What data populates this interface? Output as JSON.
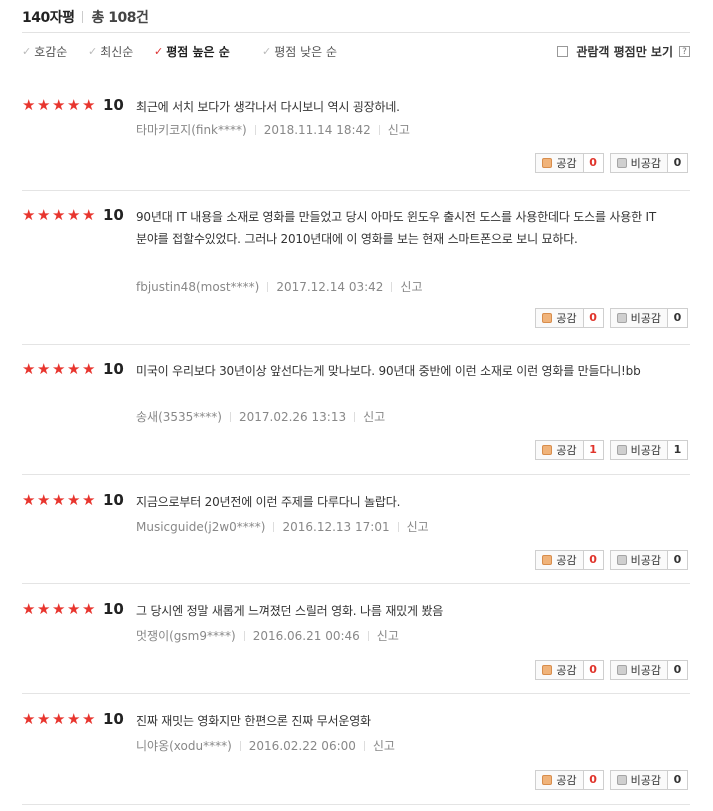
{
  "header": {
    "title": "140자평",
    "total": "총 108건"
  },
  "sort": {
    "items": [
      {
        "label": "호감순",
        "active": false
      },
      {
        "label": "최신순",
        "active": false
      },
      {
        "label": "평점 높은 순",
        "active": true
      },
      {
        "label": "평점 낮은 순",
        "active": false
      }
    ],
    "audience_only_label": "관람객 평점만 보기",
    "help_label": "?",
    "check_glyph": "✓"
  },
  "vote_labels": {
    "like": "공감",
    "dislike": "비공감"
  },
  "reviews": [
    {
      "stars": 5,
      "score": "10",
      "text": "최근에 서치 보다가 생각나서 다시보니 역시 굉장하네.",
      "user": "타마키코지(fink****)",
      "date": "2018.11.14 18:42",
      "report": "신고",
      "likes": "0",
      "dislikes": "0"
    },
    {
      "stars": 5,
      "score": "10",
      "text": "90년대 IT 내용을 소재로 영화를 만들었고 당시 아마도 윈도우 출시전 도스를 사용한데다 도스를 사용한 IT 분야를 접할수있었다. 그러나 2010년대에 이 영화를 보는 현재 스마트폰으로 보니 묘하다.",
      "user": "fbjustin48(most****)",
      "date": "2017.12.14 03:42",
      "report": "신고",
      "likes": "0",
      "dislikes": "0"
    },
    {
      "stars": 5,
      "score": "10",
      "text": "미국이 우리보다 30년이상 앞선다는게 맞나보다. 90년대 중반에 이런 소재로 이런 영화를 만들다니!bb",
      "user": "송새(3535****)",
      "date": "2017.02.26 13:13",
      "report": "신고",
      "likes": "1",
      "dislikes": "1"
    },
    {
      "stars": 5,
      "score": "10",
      "text": "지금으로부터 20년전에 이런 주제를 다루다니 놀랍다.",
      "user": "Musicguide(j2w0****)",
      "date": "2016.12.13 17:01",
      "report": "신고",
      "likes": "0",
      "dislikes": "0"
    },
    {
      "stars": 5,
      "score": "10",
      "text": "그 당시엔 정말 새롭게 느껴졌던 스릴러 영화. 나름 재밌게 봤음",
      "user": "멋쟁이(gsm9****)",
      "date": "2016.06.21 00:46",
      "report": "신고",
      "likes": "0",
      "dislikes": "0"
    },
    {
      "stars": 5,
      "score": "10",
      "text": "진짜 재밋는 영화지만 한편으론 진짜 무서운영화",
      "user": "니야옹(xodu****)",
      "date": "2016.02.22 06:00",
      "report": "신고",
      "likes": "0",
      "dislikes": "0"
    }
  ],
  "colors": {
    "star": "#e8352e",
    "like_count": "#e0342b",
    "active_check": "#d33"
  }
}
